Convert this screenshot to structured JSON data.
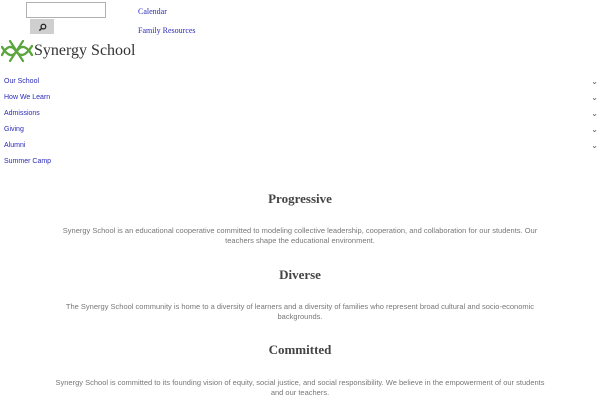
{
  "search": {
    "placeholder": "",
    "button_icon": "search-icon"
  },
  "top_links": {
    "calendar": "Calendar",
    "family_resources": "Family Resources"
  },
  "logo": {
    "text": "Synergy School",
    "icon": "leaf-logo-icon",
    "color": "#5aa53c"
  },
  "nav": {
    "items": [
      {
        "label": "Our School",
        "chevron": "⌄"
      },
      {
        "label": "How We Learn",
        "chevron": "⌄"
      },
      {
        "label": "Admissions",
        "chevron": "⌄"
      },
      {
        "label": "Giving",
        "chevron": "⌄"
      },
      {
        "label": "Alumni",
        "chevron": "⌄"
      },
      {
        "label": "Summer Camp"
      }
    ]
  },
  "values": [
    {
      "title": "Progressive",
      "text": "Synergy School is an educational cooperative committed to modeling collective leadership, cooperation, and collaboration for our students. Our teachers shape the educational environment."
    },
    {
      "title": "Diverse",
      "text": "The Synergy School community is home to a diversity of learners and a diversity of families who represent broad cultural and socio-economic backgrounds."
    },
    {
      "title": "Committed",
      "text": "Synergy School is committed to its founding vision of equity, social justice, and social responsibility. We believe in the empowerment of our students and our teachers."
    }
  ]
}
